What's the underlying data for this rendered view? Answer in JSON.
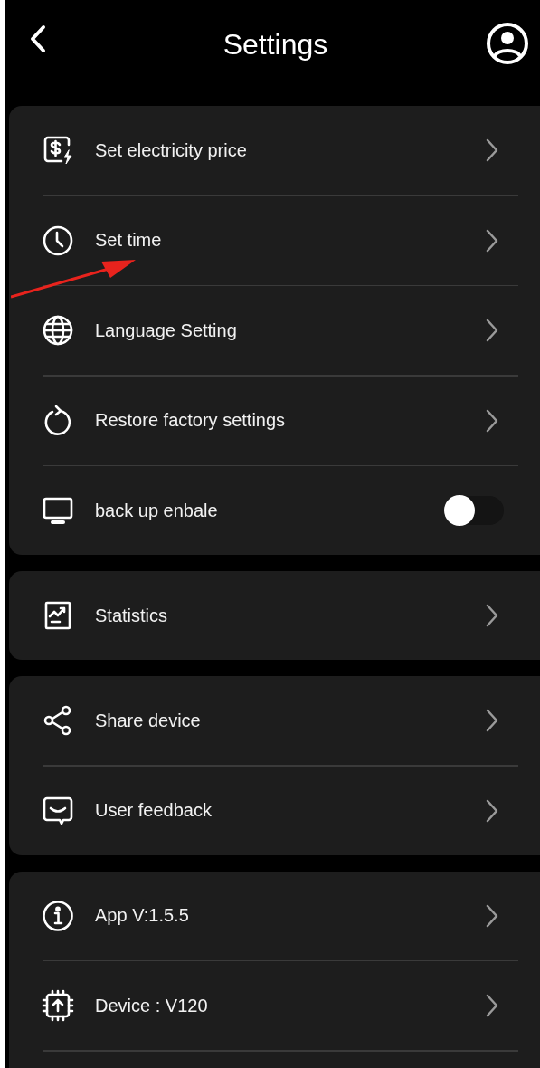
{
  "header": {
    "title": "Settings"
  },
  "groups": [
    {
      "rows": [
        {
          "kind": "link",
          "label": "Set electricity price"
        },
        {
          "kind": "link",
          "label": "Set time"
        },
        {
          "kind": "link",
          "label": "Language Setting"
        },
        {
          "kind": "link",
          "label": "Restore factory settings"
        },
        {
          "kind": "toggle",
          "label": "back up enbale",
          "on": false
        }
      ]
    },
    {
      "rows": [
        {
          "kind": "link",
          "label": "Statistics"
        }
      ]
    },
    {
      "rows": [
        {
          "kind": "link",
          "label": "Share device"
        },
        {
          "kind": "link",
          "label": "User feedback"
        }
      ]
    },
    {
      "rows": [
        {
          "kind": "link",
          "label": "App V:1.5.5"
        },
        {
          "kind": "link",
          "label": "Device : V120"
        }
      ],
      "continues": true
    }
  ]
}
